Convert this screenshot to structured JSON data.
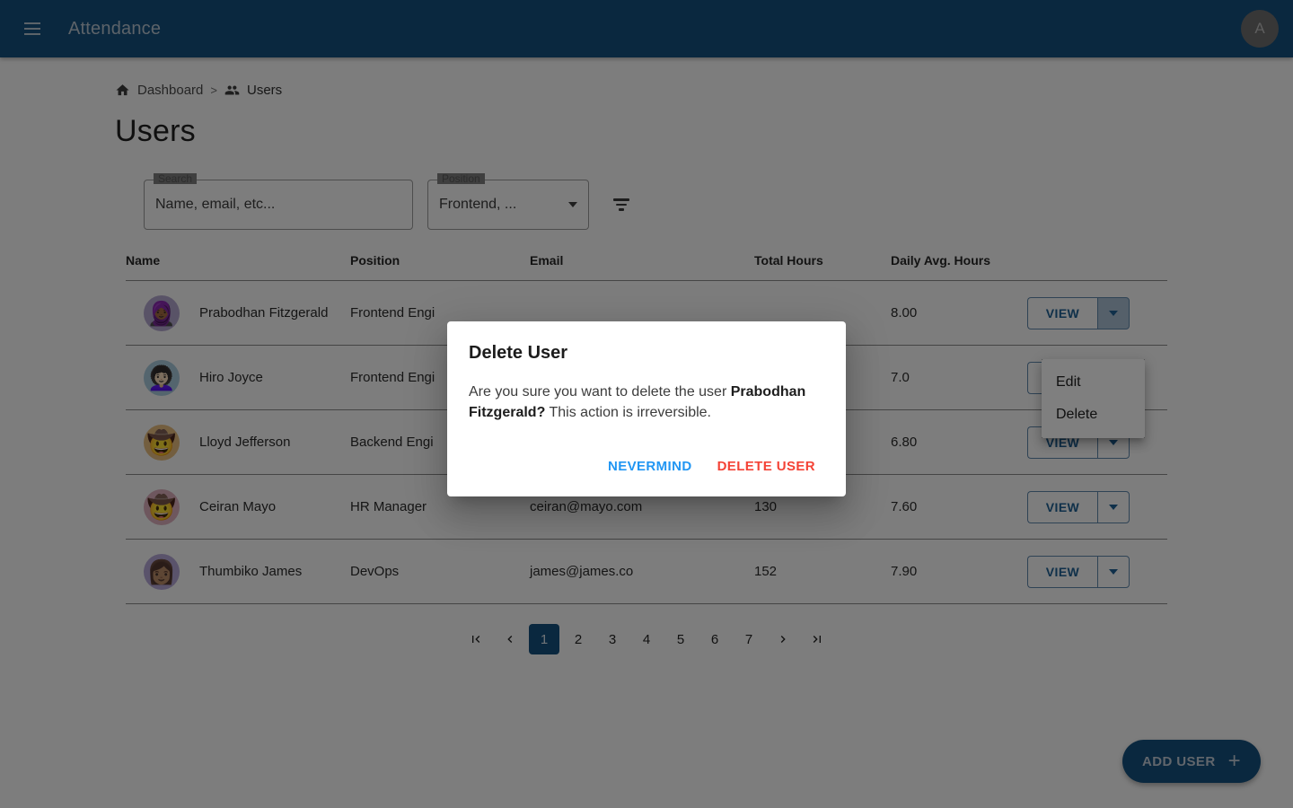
{
  "appbar": {
    "menu_icon": "hamburger-menu-icon",
    "title": "Attendance",
    "avatar_initial": "A"
  },
  "breadcrumb": {
    "home_icon": "home-icon",
    "dashboard": "Dashboard",
    "separator": ">",
    "users_icon": "people-icon",
    "users": "Users"
  },
  "page": {
    "title": "Users"
  },
  "filters": {
    "search_label": "Search",
    "search_value": "",
    "search_placeholder": "Name, email, etc...",
    "position_label": "Position",
    "position_value": "Frontend, ...",
    "filter_icon": "filter-list-icon"
  },
  "table": {
    "columns": [
      "Name",
      "Position",
      "Email",
      "Total Hours",
      "Daily Avg. Hours",
      ""
    ],
    "action_label": "VIEW",
    "rows": [
      {
        "avatar_emoji": "🧕🏾",
        "avatar_bg": "#b3a6cf",
        "name": "Prabodhan Fitzgerald",
        "position": "Frontend Engi",
        "email": "",
        "total_hours": "",
        "daily_avg_hours": "8.00"
      },
      {
        "avatar_emoji": "👩🏻‍🦱",
        "avatar_bg": "#a9cbdd",
        "name": "Hiro Joyce",
        "position": "Frontend Engi",
        "email": "",
        "total_hours": "",
        "daily_avg_hours": "7.0"
      },
      {
        "avatar_emoji": "🤠",
        "avatar_bg": "#e6bd7f",
        "name": "Lloyd Jefferson",
        "position": "Backend Engi",
        "email": "",
        "total_hours": "",
        "daily_avg_hours": "6.80"
      },
      {
        "avatar_emoji": "🤠",
        "avatar_bg": "#dcaebc",
        "name": "Ceiran Mayo",
        "position": "HR Manager",
        "email": "ceiran@mayo.com",
        "total_hours": "130",
        "daily_avg_hours": "7.60"
      },
      {
        "avatar_emoji": "👩🏽",
        "avatar_bg": "#b5a7d6",
        "name": "Thumbiko James",
        "position": "DevOps",
        "email": "james@james.co",
        "total_hours": "152",
        "daily_avg_hours": "7.90"
      }
    ]
  },
  "action_menu": {
    "items": [
      "Edit",
      "Delete"
    ]
  },
  "pagination": {
    "first_label": "first-page",
    "prev_label": "previous-page",
    "pages": [
      "1",
      "2",
      "3",
      "4",
      "5",
      "6",
      "7"
    ],
    "active_page": "1",
    "next_label": "next-page",
    "last_label": "last-page"
  },
  "fab": {
    "label": "ADD USER",
    "icon": "plus-icon"
  },
  "dialog": {
    "title": "Delete User",
    "body_prefix": "Are you sure you want to delete the user ",
    "body_name": "Prabodhan Fitzgerald?",
    "body_suffix": " This action is irreversible.",
    "cancel_label": "NEVERMIND",
    "confirm_label": "DELETE USER"
  },
  "colors": {
    "primary": "#15507e",
    "link": "#2196f3",
    "danger": "#f44336",
    "action_blue": "#1f6194"
  }
}
